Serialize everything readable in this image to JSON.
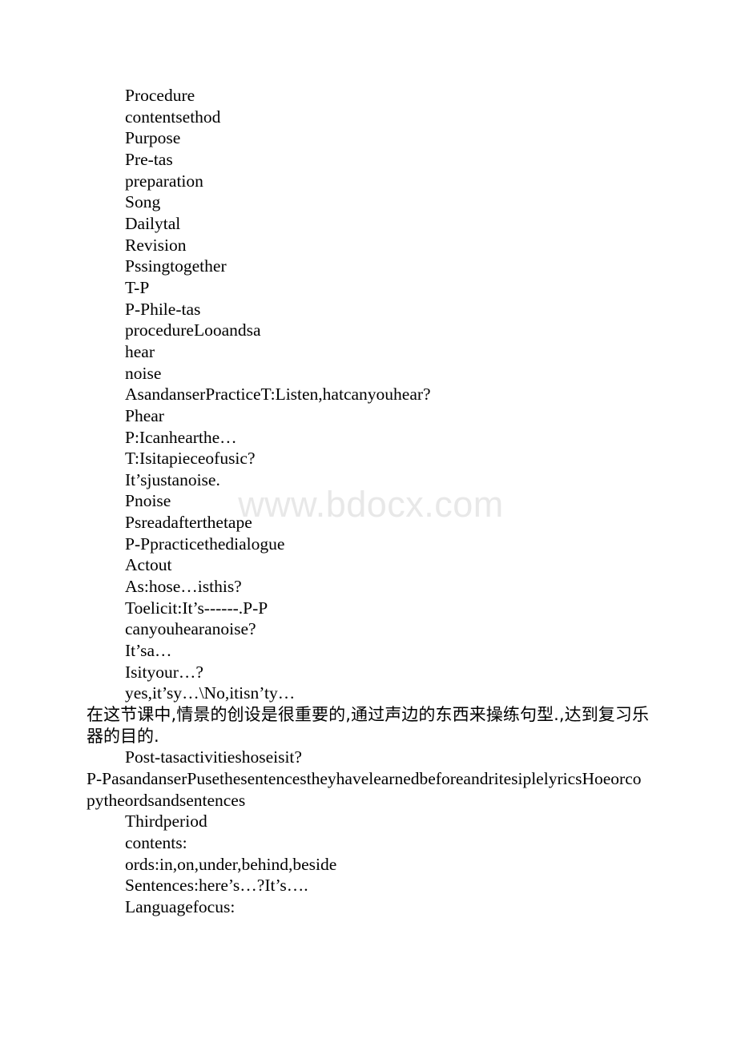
{
  "document": {
    "watermark": "www.bdocx.com",
    "lines": [
      {
        "text": "Procedure",
        "style": "indent"
      },
      {
        "text": "contentsethod",
        "style": "indent"
      },
      {
        "text": "Purpose",
        "style": "indent"
      },
      {
        "text": "Pre-tas",
        "style": "indent"
      },
      {
        "text": "preparation",
        "style": "indent"
      },
      {
        "text": "Song",
        "style": "indent"
      },
      {
        "text": "Dailytal",
        "style": "indent"
      },
      {
        "text": "Revision",
        "style": "indent"
      },
      {
        "text": "Pssingtogether",
        "style": "indent"
      },
      {
        "text": "T-P",
        "style": "indent"
      },
      {
        "text": "P-Phile-tas",
        "style": "indent"
      },
      {
        "text": "procedureLooandsa",
        "style": "indent"
      },
      {
        "text": "hear",
        "style": "indent"
      },
      {
        "text": "noise",
        "style": "indent"
      },
      {
        "text": "AsandanserPracticeT:Listen,hatcanyouhear?",
        "style": "indent"
      },
      {
        "text": "Phear",
        "style": "indent"
      },
      {
        "text": "P:Icanhearthe…",
        "style": "indent"
      },
      {
        "text": "T:Isitapieceofusic?",
        "style": "indent"
      },
      {
        "text": "It’sjustanoise.",
        "style": "indent"
      },
      {
        "text": "Pnoise",
        "style": "indent"
      },
      {
        "text": "Psreadafterthetape",
        "style": "indent"
      },
      {
        "text": "P-Ppracticethedialogue",
        "style": "indent"
      },
      {
        "text": "Actout",
        "style": "indent"
      },
      {
        "text": "As:hose…isthis?",
        "style": "indent"
      },
      {
        "text": "Toelicit:It’s------.P-P",
        "style": "indent"
      },
      {
        "text": "canyouhearanoise?",
        "style": "indent"
      },
      {
        "text": "It’sa…",
        "style": "indent"
      },
      {
        "text": "Isityour…?",
        "style": "indent"
      },
      {
        "text": "yes,it’sy…\\No,itisn’ty…",
        "style": "indent"
      },
      {
        "text": "在这节课中,情景的创设是很重要的,通过声边的东西来操练句型.,达到复习乐器的目的.",
        "style": "cjk"
      },
      {
        "text": "Post-tasactivitieshoseisit?",
        "style": "indent"
      },
      {
        "text": "P-PasandanserPusethesentencestheyhavelearnedbeforeandritesiplelyricsHoeorcopytheordsandsentences",
        "style": "wrap"
      },
      {
        "text": "Thirdperiod",
        "style": "indent"
      },
      {
        "text": "contents:",
        "style": "indent"
      },
      {
        "text": "ords:in,on,under,behind,beside",
        "style": "indent"
      },
      {
        "text": "Sentences:here’s…?It’s….",
        "style": "indent"
      },
      {
        "text": "Languagefocus:",
        "style": "indent"
      }
    ]
  }
}
